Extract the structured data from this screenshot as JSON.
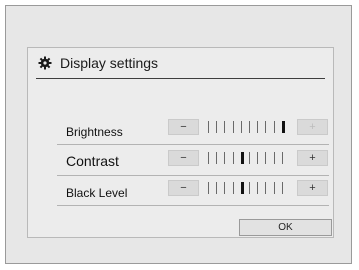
{
  "dialog": {
    "title": "Display settings",
    "title_icon": "gear-icon",
    "ok_label": "OK"
  },
  "settings": [
    {
      "label": "Brightness",
      "minus_label": "−",
      "plus_label": "+",
      "level": 10,
      "max": 10,
      "plus_enabled": false
    },
    {
      "label": "Contrast",
      "minus_label": "−",
      "plus_label": "+",
      "level": 5,
      "max": 10,
      "plus_enabled": true
    },
    {
      "label": "Black Level",
      "minus_label": "−",
      "plus_label": "+",
      "level": 5,
      "max": 10,
      "plus_enabled": true
    }
  ]
}
